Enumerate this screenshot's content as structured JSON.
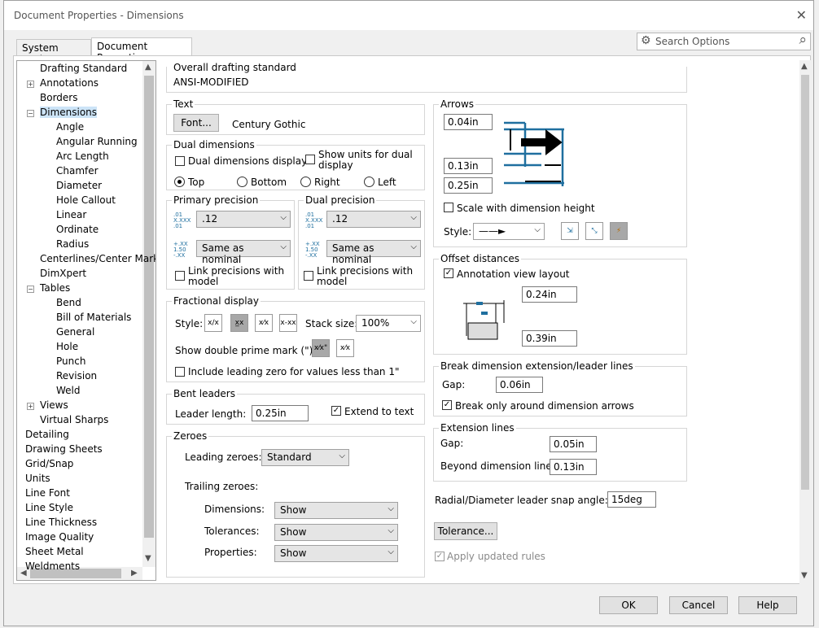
{
  "window": {
    "title": "Document Properties - Dimensions",
    "close_glyph": "✕"
  },
  "tabs": [
    {
      "label": "System Options"
    },
    {
      "label": "Document Properties"
    }
  ],
  "search": {
    "placeholder": "Search Options"
  },
  "tree": [
    {
      "label": "Drafting Standard",
      "level": 0,
      "expander": ""
    },
    {
      "label": "Annotations",
      "level": 0,
      "expander": "+"
    },
    {
      "label": "Borders",
      "level": 0,
      "expander": ""
    },
    {
      "label": "Dimensions",
      "level": 0,
      "expander": "−",
      "selected": true
    },
    {
      "label": "Angle",
      "level": 1
    },
    {
      "label": "Angular Running",
      "level": 1
    },
    {
      "label": "Arc Length",
      "level": 1
    },
    {
      "label": "Chamfer",
      "level": 1
    },
    {
      "label": "Diameter",
      "level": 1
    },
    {
      "label": "Hole Callout",
      "level": 1
    },
    {
      "label": "Linear",
      "level": 1
    },
    {
      "label": "Ordinate",
      "level": 1
    },
    {
      "label": "Radius",
      "level": 1
    },
    {
      "label": "Centerlines/Center Mark",
      "level": 0,
      "expander": ""
    },
    {
      "label": "DimXpert",
      "level": 0,
      "expander": ""
    },
    {
      "label": "Tables",
      "level": 0,
      "expander": "−"
    },
    {
      "label": "Bend",
      "level": 1
    },
    {
      "label": "Bill of Materials",
      "level": 1
    },
    {
      "label": "General",
      "level": 1
    },
    {
      "label": "Hole",
      "level": 1
    },
    {
      "label": "Punch",
      "level": 1
    },
    {
      "label": "Revision",
      "level": 1
    },
    {
      "label": "Weld",
      "level": 1
    },
    {
      "label": "Views",
      "level": 0,
      "expander": "+"
    },
    {
      "label": "Virtual Sharps",
      "level": 0,
      "expander": ""
    },
    {
      "label": "Detailing",
      "level": -1
    },
    {
      "label": "Drawing Sheets",
      "level": -1
    },
    {
      "label": "Grid/Snap",
      "level": -1
    },
    {
      "label": "Units",
      "level": -1
    },
    {
      "label": "Line Font",
      "level": -1
    },
    {
      "label": "Line Style",
      "level": -1
    },
    {
      "label": "Line Thickness",
      "level": -1
    },
    {
      "label": "Image Quality",
      "level": -1
    },
    {
      "label": "Sheet Metal",
      "level": -1
    },
    {
      "label": "Weldments",
      "level": -1
    }
  ],
  "overall": {
    "label": "Overall drafting standard",
    "value": "ANSI-MODIFIED"
  },
  "text": {
    "label": "Text",
    "font_button": "Font...",
    "font_name": "Century Gothic"
  },
  "dual": {
    "label": "Dual dimensions",
    "display": "Dual dimensions display",
    "show_units": "Show units for dual display",
    "top": "Top",
    "bottom": "Bottom",
    "right": "Right",
    "left": "Left"
  },
  "primary": {
    "label": "Primary precision",
    "value": ".12",
    "tol": "Same as nominal",
    "link": "Link precisions with model"
  },
  "dualprec": {
    "label": "Dual precision",
    "value": ".12",
    "tol": "Same as nominal",
    "link": "Link precisions with model"
  },
  "fractional": {
    "label": "Fractional display",
    "style": "Style:",
    "stack_label": "Stack size:",
    "stack_value": "100%",
    "double_prime": "Show double prime mark (\"):",
    "leading_zero": "Include leading zero for values less than 1\""
  },
  "bent": {
    "label": "Bent leaders",
    "length_label": "Leader length:",
    "length": "0.25in",
    "extend": "Extend to text"
  },
  "zeroes": {
    "label": "Zeroes",
    "leading_label": "Leading zeroes:",
    "leading": "Standard",
    "trailing_label": "Trailing zeroes:",
    "dimensions_label": "Dimensions:",
    "dimensions": "Show",
    "tolerances_label": "Tolerances:",
    "tolerances": "Show",
    "properties_label": "Properties:",
    "properties": "Show"
  },
  "arrows": {
    "label": "Arrows",
    "v1": "0.04in",
    "v2": "0.13in",
    "v3": "0.25in",
    "scale": "Scale with dimension height",
    "style": "Style:"
  },
  "offset": {
    "label": "Offset distances",
    "annotation": "Annotation view layout",
    "v1": "0.24in",
    "v2": "0.39in"
  },
  "break": {
    "label": "Break dimension extension/leader lines",
    "gap_label": "Gap:",
    "gap": "0.06in",
    "only_around": "Break only around dimension arrows"
  },
  "extension": {
    "label": "Extension lines",
    "gap_label": "Gap:",
    "gap": "0.05in",
    "beyond_label": "Beyond dimension line:",
    "beyond": "0.13in"
  },
  "radial": {
    "label": "Radial/Diameter leader snap angle:",
    "value": "15deg"
  },
  "tolerance_button": "Tolerance...",
  "apply_rules": "Apply updated rules",
  "buttons": {
    "ok": "OK",
    "cancel": "Cancel",
    "help": "Help"
  },
  "colors": {
    "accent": "#1f6f9f",
    "selected": "#cce4f7"
  }
}
